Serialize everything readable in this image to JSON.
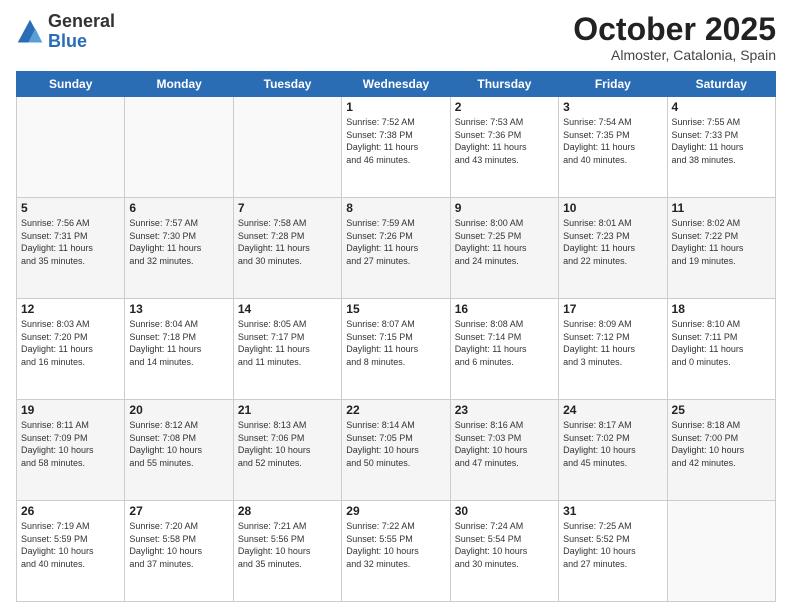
{
  "header": {
    "logo_general": "General",
    "logo_blue": "Blue",
    "title": "October 2025",
    "location": "Almoster, Catalonia, Spain"
  },
  "weekdays": [
    "Sunday",
    "Monday",
    "Tuesday",
    "Wednesday",
    "Thursday",
    "Friday",
    "Saturday"
  ],
  "weeks": [
    [
      {
        "day": "",
        "info": ""
      },
      {
        "day": "",
        "info": ""
      },
      {
        "day": "",
        "info": ""
      },
      {
        "day": "1",
        "info": "Sunrise: 7:52 AM\nSunset: 7:38 PM\nDaylight: 11 hours\nand 46 minutes."
      },
      {
        "day": "2",
        "info": "Sunrise: 7:53 AM\nSunset: 7:36 PM\nDaylight: 11 hours\nand 43 minutes."
      },
      {
        "day": "3",
        "info": "Sunrise: 7:54 AM\nSunset: 7:35 PM\nDaylight: 11 hours\nand 40 minutes."
      },
      {
        "day": "4",
        "info": "Sunrise: 7:55 AM\nSunset: 7:33 PM\nDaylight: 11 hours\nand 38 minutes."
      }
    ],
    [
      {
        "day": "5",
        "info": "Sunrise: 7:56 AM\nSunset: 7:31 PM\nDaylight: 11 hours\nand 35 minutes."
      },
      {
        "day": "6",
        "info": "Sunrise: 7:57 AM\nSunset: 7:30 PM\nDaylight: 11 hours\nand 32 minutes."
      },
      {
        "day": "7",
        "info": "Sunrise: 7:58 AM\nSunset: 7:28 PM\nDaylight: 11 hours\nand 30 minutes."
      },
      {
        "day": "8",
        "info": "Sunrise: 7:59 AM\nSunset: 7:26 PM\nDaylight: 11 hours\nand 27 minutes."
      },
      {
        "day": "9",
        "info": "Sunrise: 8:00 AM\nSunset: 7:25 PM\nDaylight: 11 hours\nand 24 minutes."
      },
      {
        "day": "10",
        "info": "Sunrise: 8:01 AM\nSunset: 7:23 PM\nDaylight: 11 hours\nand 22 minutes."
      },
      {
        "day": "11",
        "info": "Sunrise: 8:02 AM\nSunset: 7:22 PM\nDaylight: 11 hours\nand 19 minutes."
      }
    ],
    [
      {
        "day": "12",
        "info": "Sunrise: 8:03 AM\nSunset: 7:20 PM\nDaylight: 11 hours\nand 16 minutes."
      },
      {
        "day": "13",
        "info": "Sunrise: 8:04 AM\nSunset: 7:18 PM\nDaylight: 11 hours\nand 14 minutes."
      },
      {
        "day": "14",
        "info": "Sunrise: 8:05 AM\nSunset: 7:17 PM\nDaylight: 11 hours\nand 11 minutes."
      },
      {
        "day": "15",
        "info": "Sunrise: 8:07 AM\nSunset: 7:15 PM\nDaylight: 11 hours\nand 8 minutes."
      },
      {
        "day": "16",
        "info": "Sunrise: 8:08 AM\nSunset: 7:14 PM\nDaylight: 11 hours\nand 6 minutes."
      },
      {
        "day": "17",
        "info": "Sunrise: 8:09 AM\nSunset: 7:12 PM\nDaylight: 11 hours\nand 3 minutes."
      },
      {
        "day": "18",
        "info": "Sunrise: 8:10 AM\nSunset: 7:11 PM\nDaylight: 11 hours\nand 0 minutes."
      }
    ],
    [
      {
        "day": "19",
        "info": "Sunrise: 8:11 AM\nSunset: 7:09 PM\nDaylight: 10 hours\nand 58 minutes."
      },
      {
        "day": "20",
        "info": "Sunrise: 8:12 AM\nSunset: 7:08 PM\nDaylight: 10 hours\nand 55 minutes."
      },
      {
        "day": "21",
        "info": "Sunrise: 8:13 AM\nSunset: 7:06 PM\nDaylight: 10 hours\nand 52 minutes."
      },
      {
        "day": "22",
        "info": "Sunrise: 8:14 AM\nSunset: 7:05 PM\nDaylight: 10 hours\nand 50 minutes."
      },
      {
        "day": "23",
        "info": "Sunrise: 8:16 AM\nSunset: 7:03 PM\nDaylight: 10 hours\nand 47 minutes."
      },
      {
        "day": "24",
        "info": "Sunrise: 8:17 AM\nSunset: 7:02 PM\nDaylight: 10 hours\nand 45 minutes."
      },
      {
        "day": "25",
        "info": "Sunrise: 8:18 AM\nSunset: 7:00 PM\nDaylight: 10 hours\nand 42 minutes."
      }
    ],
    [
      {
        "day": "26",
        "info": "Sunrise: 7:19 AM\nSunset: 5:59 PM\nDaylight: 10 hours\nand 40 minutes."
      },
      {
        "day": "27",
        "info": "Sunrise: 7:20 AM\nSunset: 5:58 PM\nDaylight: 10 hours\nand 37 minutes."
      },
      {
        "day": "28",
        "info": "Sunrise: 7:21 AM\nSunset: 5:56 PM\nDaylight: 10 hours\nand 35 minutes."
      },
      {
        "day": "29",
        "info": "Sunrise: 7:22 AM\nSunset: 5:55 PM\nDaylight: 10 hours\nand 32 minutes."
      },
      {
        "day": "30",
        "info": "Sunrise: 7:24 AM\nSunset: 5:54 PM\nDaylight: 10 hours\nand 30 minutes."
      },
      {
        "day": "31",
        "info": "Sunrise: 7:25 AM\nSunset: 5:52 PM\nDaylight: 10 hours\nand 27 minutes."
      },
      {
        "day": "",
        "info": ""
      }
    ]
  ]
}
